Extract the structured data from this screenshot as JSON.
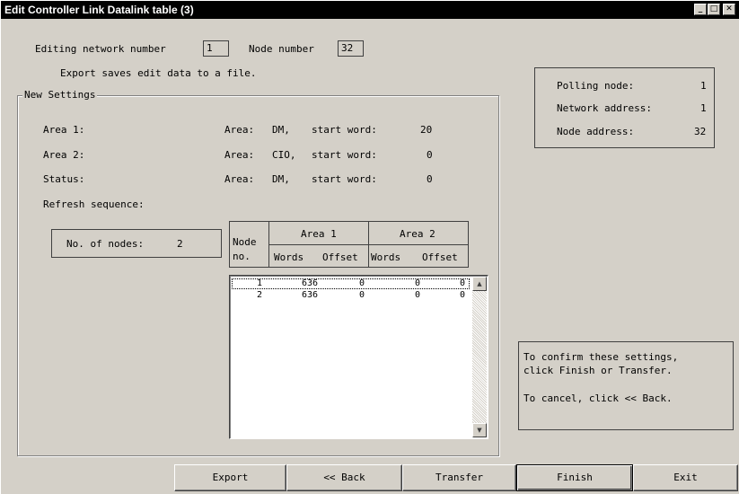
{
  "window": {
    "title": "Edit Controller Link Datalink table (3)",
    "buttons": {
      "minimize": "_",
      "maximize": "□",
      "close": "✕"
    }
  },
  "header": {
    "network_label": "Editing network number",
    "network_value": "1",
    "node_label": "Node number",
    "node_value": "32",
    "export_note": "Export saves edit data to a file."
  },
  "new_settings": {
    "label": "New Settings",
    "rows": [
      {
        "name": "Area 1:",
        "area_label": "Area:",
        "area": "DM,",
        "start_label": "start word:",
        "start": "20"
      },
      {
        "name": "Area 2:",
        "area_label": "Area:",
        "area": "CIO,",
        "start_label": "start word:",
        "start": "0"
      },
      {
        "name": "Status:",
        "area_label": "Area:",
        "area": "DM,",
        "start_label": "start word:",
        "start": "0"
      }
    ],
    "refresh_sequence_label": "Refresh sequence:",
    "nodes_label": "No. of nodes:",
    "nodes_value": "2"
  },
  "table": {
    "node_header_line1": "Node",
    "node_header_line2": "no.",
    "area1_header": "Area 1",
    "area2_header": "Area 2",
    "sub_headers": [
      "Words",
      "Offset",
      "Words",
      "Offset"
    ],
    "rows": [
      {
        "node": "1",
        "a1_words": "636",
        "a1_offset": "0",
        "a2_words": "0",
        "a2_offset": "0"
      },
      {
        "node": "2",
        "a1_words": "636",
        "a1_offset": "0",
        "a2_words": "0",
        "a2_offset": "0"
      }
    ]
  },
  "info_box": {
    "polling_label": "Polling node:",
    "polling_value": "1",
    "network_label": "Network address:",
    "network_value": "1",
    "node_label": "Node address:",
    "node_value": "32"
  },
  "hint_box": {
    "line1": "To confirm these settings,",
    "line2": "click Finish or Transfer.",
    "line3": "To cancel, click << Back."
  },
  "footer": {
    "export": "Export",
    "back": "<< Back",
    "transfer": "Transfer",
    "finish": "Finish",
    "exit": "Exit"
  },
  "icons": {
    "scroll_up": "arrow-up-icon",
    "scroll_down": "arrow-down-icon"
  }
}
